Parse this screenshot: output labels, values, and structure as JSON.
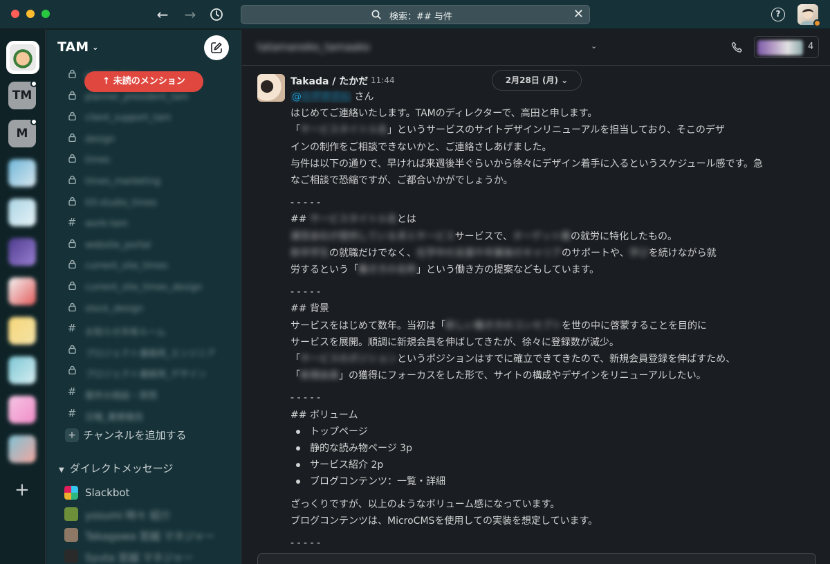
{
  "titlebar": {
    "search_text": "検索：## 与件",
    "nav_back": "←",
    "nav_forward": "→",
    "close_glyph": "✕",
    "help_glyph": "?"
  },
  "rail": {
    "workspaces": [
      "TM",
      "M"
    ],
    "add_glyph": "+"
  },
  "sidebar": {
    "workspace_name": "TAM",
    "workspace_chevron": "⌄",
    "mention_pill": "↑ 未読のメンション",
    "channels": [
      {
        "icon": "lock",
        "name": "private_tam"
      },
      {
        "icon": "lock",
        "name": "planner_president_tam"
      },
      {
        "icon": "lock",
        "name": "client_support_tam"
      },
      {
        "icon": "lock",
        "name": "design"
      },
      {
        "icon": "lock",
        "name": "times"
      },
      {
        "icon": "lock",
        "name": "times_marketing"
      },
      {
        "icon": "lock",
        "name": "03-studio_times"
      },
      {
        "icon": "hash",
        "name": "work-tam"
      },
      {
        "icon": "lock",
        "name": "website_portal"
      },
      {
        "icon": "lock",
        "name": "current_site_times"
      },
      {
        "icon": "lock",
        "name": "current_site_times_design"
      },
      {
        "icon": "lock",
        "name": "stock_design"
      },
      {
        "icon": "hash",
        "name": "お知らせ共有ルーム"
      },
      {
        "icon": "lock",
        "name": "プロジェクト連絡用_エンジニア"
      },
      {
        "icon": "lock",
        "name": "プロジェクト連絡用_デザイン"
      },
      {
        "icon": "hash",
        "name": "案件の相談・質問"
      },
      {
        "icon": "hash",
        "name": "日報_業務報告"
      }
    ],
    "add_channel": "チャンネルを追加する",
    "add_channel_glyph": "+",
    "dm_header": "ダイレクトメッセージ",
    "dm_caret": "▼",
    "dms": [
      {
        "name": "Slackbot",
        "blur": false,
        "color": "#ecb22e"
      },
      {
        "name": "yosumi 時々 紹介",
        "blur": true,
        "color": "#6e8f3a"
      },
      {
        "name": "Takagawa 宮越 マネジャー",
        "blur": true,
        "color": "#8d7865"
      },
      {
        "name": "Syuta 宮越 マネジャー",
        "blur": true,
        "color": "#2a2a2a"
      }
    ]
  },
  "channel": {
    "title": "tatamaneko_tamaako",
    "chevron": "⌄",
    "member_count": "4"
  },
  "message": {
    "author": "Takada / たかだ",
    "time": "11:44",
    "date_divider": "2月28日 (月) ⌄",
    "mention": "@",
    "mention_name": "ヒデオさん",
    "mention_suffix": "さん",
    "line1": "はじめてご連絡いたします。TAMのディレクターで、高田と申します。",
    "line2a": "「",
    "line2b": "サービスタイトル名",
    "line2c": "」というサービスのサイトデザインリニューアルを担当しており、そこのデザ",
    "line3": "インの制作をご相談できないかと、ご連絡さしあげました。",
    "line4": "与件は以下の通りで、早ければ来週後半ぐらいから徐々にデザイン着手に入るというスケジュール感です。急",
    "line5": "なご相談で恐縮ですが、ご都合いかがでしょうか。",
    "sep": "- - - - -",
    "about_a": "## ",
    "about_b": "サービスタイトル名",
    "about_c": "とは",
    "p1a": "運営会社が提供している",
    "p1b": "求人サービス",
    "p1c": "サービスで、",
    "p1d": "ターゲット層",
    "p1e": "の就労に特化したもの。",
    "p2a": "新卒学生",
    "p2b": "の就職だけでなく、",
    "p2c": "在学中の支援や卒業後のキャリア",
    "p2d": "のサポートや、",
    "p2e": "学び",
    "p2f": "を続けながら就",
    "p3a": "労するという「",
    "p3b": "働き方の名称",
    "p3c": "」という働き方の提案などもしています。",
    "bg_head": "## 背景",
    "b1a": "サービスをはじめて数年。当初は「",
    "b1b": "新しい働き方のコンセプト",
    "b1c": "を世の中に啓蒙することを目的に",
    "b2": "サービスを展開。順調に新規会員を伸ばしてきたが、徐々に登録数が減少。",
    "b3a": "「",
    "b3b": "サービスのポジション",
    "b3c": "というポジションはすでに確立できてきたので、新規会員登録を伸ばすため、",
    "b4a": "「",
    "b4b": "新規会員",
    "b4c": "」の獲得にフォーカスをした形で、サイトの構成やデザインをリニューアルしたい。",
    "vol_head": "## ボリューム",
    "bullets": [
      "トップページ",
      "静的な読み物ページ 3p",
      "サービス紹介 2p",
      "ブログコンテンツ：一覧・詳細"
    ],
    "c1": "ざっくりですが、以上のようなボリューム感になっています。",
    "c2": "ブログコンテンツは、MicroCMSを使用しての実装を想定しています。"
  }
}
